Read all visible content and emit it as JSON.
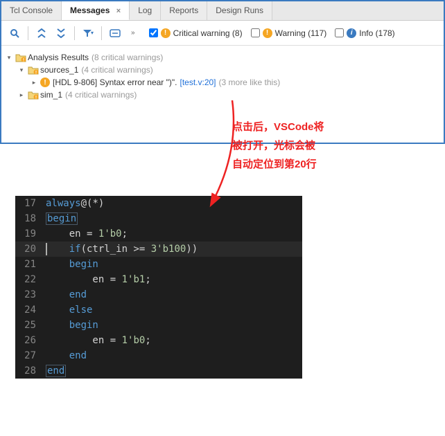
{
  "tabs": {
    "items": [
      {
        "label": "Tcl Console",
        "active": false
      },
      {
        "label": "Messages",
        "active": true,
        "closeable": true
      },
      {
        "label": "Log",
        "active": false
      },
      {
        "label": "Reports",
        "active": false
      },
      {
        "label": "Design Runs",
        "active": false
      }
    ]
  },
  "toolbar": {
    "chevron": "»"
  },
  "filters": {
    "critical": {
      "checked": true,
      "label": "Critical warning (8)"
    },
    "warning": {
      "checked": false,
      "label": "Warning (117)"
    },
    "info": {
      "checked": false,
      "label": "Info (178)"
    }
  },
  "tree": {
    "root": {
      "label": "Analysis Results",
      "meta": "(8 critical warnings)"
    },
    "sources": {
      "label": "sources_1",
      "meta": "(4 critical warnings)"
    },
    "msg": {
      "prefix": "[HDL 9-806] Syntax error near \")\". ",
      "link": "[test.v:20]",
      "suffix": " (3 more like this)"
    },
    "sim": {
      "label": "sim_1",
      "meta": "(4 critical warnings)"
    }
  },
  "annotation": {
    "line1": "点击后，VSCode将",
    "line2": "被打开，光标会被",
    "line3": "自动定位到第20行"
  },
  "code": {
    "lines": [
      {
        "n": "17",
        "tokens": [
          [
            "kw1",
            "always"
          ],
          [
            "op",
            "@("
          ],
          [
            "op",
            "*"
          ],
          [
            "op",
            ")"
          ]
        ]
      },
      {
        "n": "18",
        "tokens": [
          [
            "kw1 boxed",
            "begin"
          ]
        ]
      },
      {
        "n": "19",
        "tokens": [
          [
            "op",
            "    en "
          ],
          [
            "op",
            "="
          ],
          [
            "op",
            " "
          ],
          [
            "num",
            "1'b0"
          ],
          [
            "op",
            ";"
          ]
        ]
      },
      {
        "n": "20",
        "current": true,
        "tokens": [
          [
            "op",
            "    "
          ],
          [
            "kw1",
            "if"
          ],
          [
            "op",
            "(ctrl_in "
          ],
          [
            "op",
            ">="
          ],
          [
            "op",
            " "
          ],
          [
            "num",
            "3'b100"
          ],
          [
            "op",
            "))"
          ]
        ]
      },
      {
        "n": "21",
        "tokens": [
          [
            "op",
            "    "
          ],
          [
            "kw1",
            "begin"
          ]
        ]
      },
      {
        "n": "22",
        "tokens": [
          [
            "op",
            "        en "
          ],
          [
            "op",
            "="
          ],
          [
            "op",
            " "
          ],
          [
            "num",
            "1'b1"
          ],
          [
            "op",
            ";"
          ]
        ]
      },
      {
        "n": "23",
        "tokens": [
          [
            "op",
            "    "
          ],
          [
            "kw1",
            "end"
          ]
        ]
      },
      {
        "n": "24",
        "tokens": [
          [
            "op",
            "    "
          ],
          [
            "kw1",
            "else"
          ]
        ]
      },
      {
        "n": "25",
        "tokens": [
          [
            "op",
            "    "
          ],
          [
            "kw1",
            "begin"
          ]
        ]
      },
      {
        "n": "26",
        "tokens": [
          [
            "op",
            "        en "
          ],
          [
            "op",
            "="
          ],
          [
            "op",
            " "
          ],
          [
            "num",
            "1'b0"
          ],
          [
            "op",
            ";"
          ]
        ]
      },
      {
        "n": "27",
        "tokens": [
          [
            "op",
            "    "
          ],
          [
            "kw1",
            "end"
          ]
        ]
      },
      {
        "n": "28",
        "tokens": [
          [
            "kw1 boxed",
            "end"
          ]
        ]
      }
    ]
  }
}
